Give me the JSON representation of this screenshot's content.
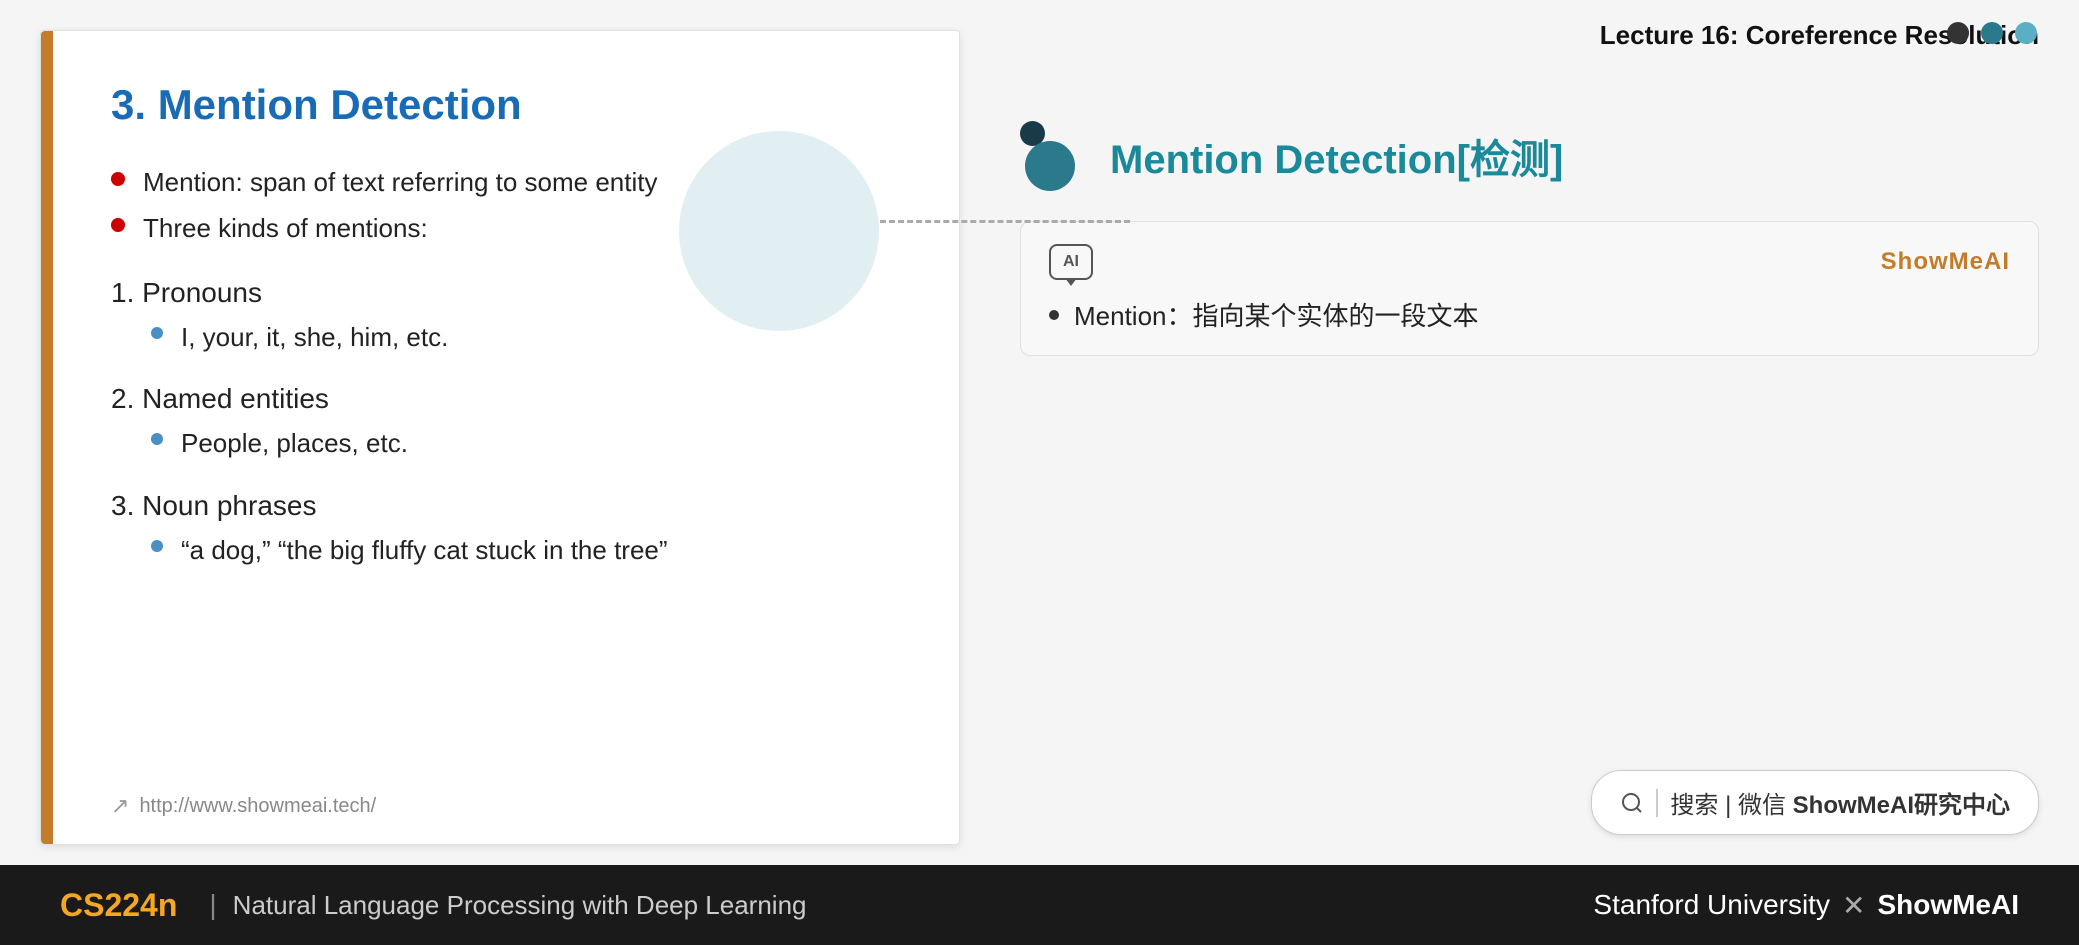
{
  "lecture": {
    "header": "Lecture 16: Coreference Resolution"
  },
  "slide": {
    "title": "3. Mention Detection",
    "left_border_color": "#c47c2b",
    "bullets": [
      "Mention: span of text referring to some entity",
      "Three kinds of mentions:"
    ],
    "numbered_sections": [
      {
        "number": "1.",
        "title": "Pronouns",
        "sub_bullets": [
          "I, your, it, she, him, etc."
        ]
      },
      {
        "number": "2.",
        "title": "Named entities",
        "sub_bullets": [
          "People, places, etc."
        ]
      },
      {
        "number": "3.",
        "title": "Noun phrases",
        "sub_bullets": [
          "“a dog,” “the big fluffy cat stuck in the tree”"
        ]
      }
    ],
    "url_icon": "↗",
    "url": "http://www.showmeai.tech/"
  },
  "right_panel": {
    "title": "Mention Detection[检测]",
    "nav_dots": [
      "dark",
      "teal",
      "blue-med"
    ],
    "translation_card": {
      "brand": "ShowMeAI",
      "content": "Mention：指向某个实体的一段文本"
    }
  },
  "search_bar": {
    "text": "搜索 | 微信 ShowMeAI研究中心"
  },
  "bottom_bar": {
    "cs224n": "CS224n",
    "separator": "|",
    "subtitle": "Natural Language Processing with Deep Learning",
    "right_text": "Stanford University X ShowMeAI"
  }
}
